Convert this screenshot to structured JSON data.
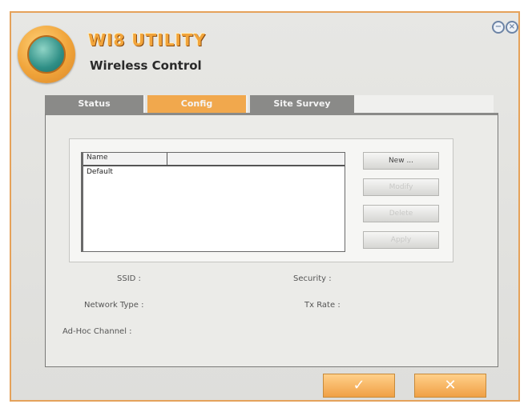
{
  "app": {
    "title": "WI8 UTILITY",
    "subtitle": "Wireless Control"
  },
  "window_controls": {
    "minimize_glyph": "−",
    "close_glyph": "×"
  },
  "tabs": [
    {
      "label": "Status",
      "active": false
    },
    {
      "label": "Config",
      "active": true
    },
    {
      "label": "Site Survey",
      "active": false
    }
  ],
  "profile_list": {
    "column_header": "Name",
    "rows": [
      "Default"
    ]
  },
  "buttons": {
    "new": "New ...",
    "edit": "Modify",
    "delete": "Delete",
    "apply": "Apply"
  },
  "info": {
    "ssid": "SSID :",
    "security": "Security :",
    "network_type": "Network Type :",
    "tx_rate": "Tx Rate :",
    "adhoc_channel": "Ad-Hoc Channel :"
  },
  "dialog": {
    "ok_glyph": "✓",
    "cancel_glyph": "✕"
  },
  "colors": {
    "accent": "#f1a84d",
    "tab_inactive": "#8a8a88",
    "border": "#e5a25a"
  }
}
